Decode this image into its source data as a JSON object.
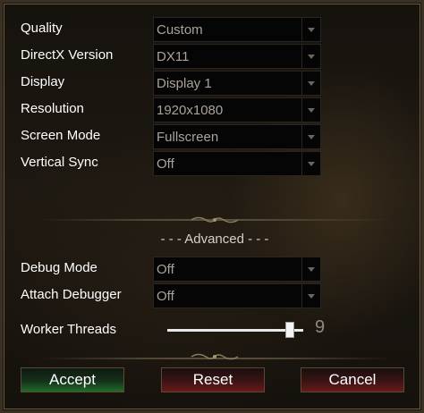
{
  "settings": [
    {
      "label": "Quality",
      "value": "Custom"
    },
    {
      "label": "DirectX Version",
      "value": "DX11"
    },
    {
      "label": "Display",
      "value": "Display 1"
    },
    {
      "label": "Resolution",
      "value": "1920x1080"
    },
    {
      "label": "Screen Mode",
      "value": "Fullscreen"
    },
    {
      "label": "Vertical Sync",
      "value": "Off"
    }
  ],
  "advanced": {
    "title": "- - - Advanced - - -",
    "settings": [
      {
        "label": "Debug Mode",
        "value": "Off"
      },
      {
        "label": "Attach Debugger",
        "value": "Off"
      }
    ],
    "worker_threads": {
      "label": "Worker Threads",
      "value": "9",
      "fill": 0.9
    }
  },
  "buttons": {
    "accept": "Accept",
    "reset": "Reset",
    "cancel": "Cancel"
  },
  "icons": {
    "dropdown": "chevron-down-icon",
    "ornament": "scroll-ornament-icon"
  },
  "colors": {
    "accept": "#1f6a2a",
    "reset": "#6a1a1a",
    "cancel": "#6a1a1a"
  }
}
